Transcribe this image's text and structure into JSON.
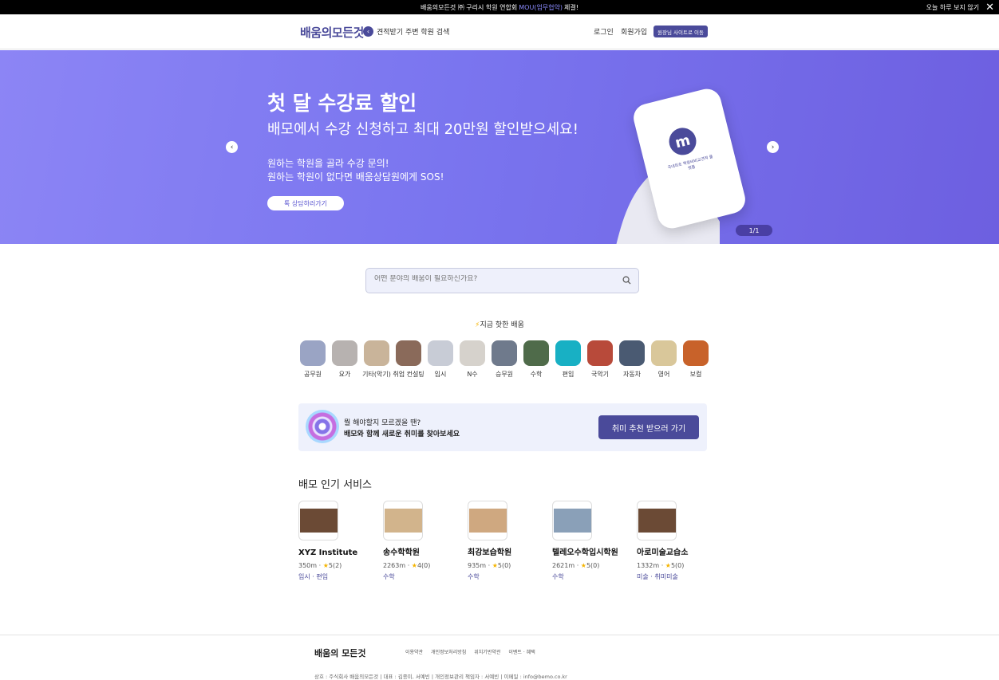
{
  "topbar": {
    "text_before": "배움의모든것 ㈜ 구리시 학원 연합회",
    "highlight": "MOU(업무협약)",
    "text_after": "체결!",
    "dismiss_label": "오늘 하루 보지 않기",
    "close_icon": "close-icon"
  },
  "header": {
    "logo": "배움의모든것",
    "back_icon": "chevron-left-icon",
    "subnav": "견적받기 주변 학원 검색",
    "login": "로그인",
    "signup": "회원가입",
    "director": "원장님 사이트로 이동"
  },
  "banner": {
    "title": "첫 달 수강료 할인",
    "subtitle": "배모에서 수강 신청하고 최대 20만원 할인받으세요!",
    "line1": "원하는 학원을 골라 수강 문의!",
    "line2": "원하는 학원이 없다면 배움상담원에게 SOS!",
    "cta": "톡 상담하러가기",
    "phone_text": "국내최초 학원비비교견적 플랫폼",
    "pager": "1/1",
    "gradient": [
      "#8c85f5",
      "#6d5fe0"
    ]
  },
  "search": {
    "placeholder": "어떤 분야의 배움이 필요하신가요?",
    "icon": "search-icon"
  },
  "hot": {
    "title": "지금 핫한 배움",
    "icon": "lightning-icon"
  },
  "categories": [
    {
      "label": "공무원",
      "color": "#9aa4c4"
    },
    {
      "label": "요가",
      "color": "#b7b2b0"
    },
    {
      "label": "기타(악기)",
      "color": "#c9b49a"
    },
    {
      "label": "취업 컨설팅",
      "color": "#8a6a5a"
    },
    {
      "label": "입시",
      "color": "#c8ccd6"
    },
    {
      "label": "N수",
      "color": "#d6d2cc"
    },
    {
      "label": "승무원",
      "color": "#6f7a8c"
    },
    {
      "label": "수학",
      "color": "#4f6b4a"
    },
    {
      "label": "편입",
      "color": "#18b0c4"
    },
    {
      "label": "국악기",
      "color": "#b84a3a"
    },
    {
      "label": "자동차",
      "color": "#4a5a72"
    },
    {
      "label": "영어",
      "color": "#d9c79a"
    },
    {
      "label": "보컬",
      "color": "#c8622a"
    }
  ],
  "promo": {
    "line1": "뭘 해야할지 모르겠을 땐?",
    "line2": "배모와 함께 새로운 취미를 찾아보세요",
    "button": "취미 추천 받으러 가기"
  },
  "popular": {
    "title": "배모 인기 서비스",
    "items": [
      {
        "name": "XYZ Institute",
        "distance": "350m",
        "rating": "5(2)",
        "tags": [
          "입시",
          "편입"
        ],
        "pic": "#6b4a35"
      },
      {
        "name": "송수학학원",
        "distance": "2263m",
        "rating": "4(0)",
        "tags": [
          "수학"
        ],
        "pic": "#d2b48c"
      },
      {
        "name": "최강보습학원",
        "distance": "935m",
        "rating": "5(0)",
        "tags": [
          "수학"
        ],
        "pic": "#cfa880"
      },
      {
        "name": "텔레오수학입시학원",
        "distance": "2621m",
        "rating": "5(0)",
        "tags": [
          "수학"
        ],
        "pic": "#8aa0b8"
      },
      {
        "name": "아로미술교습소",
        "distance": "1332m",
        "rating": "5(0)",
        "tags": [
          "미술",
          "취미미술"
        ],
        "pic": "#6b4a35"
      }
    ]
  },
  "footer": {
    "logo": "배움의 모든것",
    "links": [
      "이용약관",
      "개인정보처리방침",
      "위치기반약관",
      "이벤트 · 혜택"
    ],
    "info": "상호 : 주식회사 배움의모든것  |  대표 : 김종미, 서예빈  |  개인정보관리 책임자 : 서예빈  |  이메일 : info@bemo.co.kr"
  }
}
